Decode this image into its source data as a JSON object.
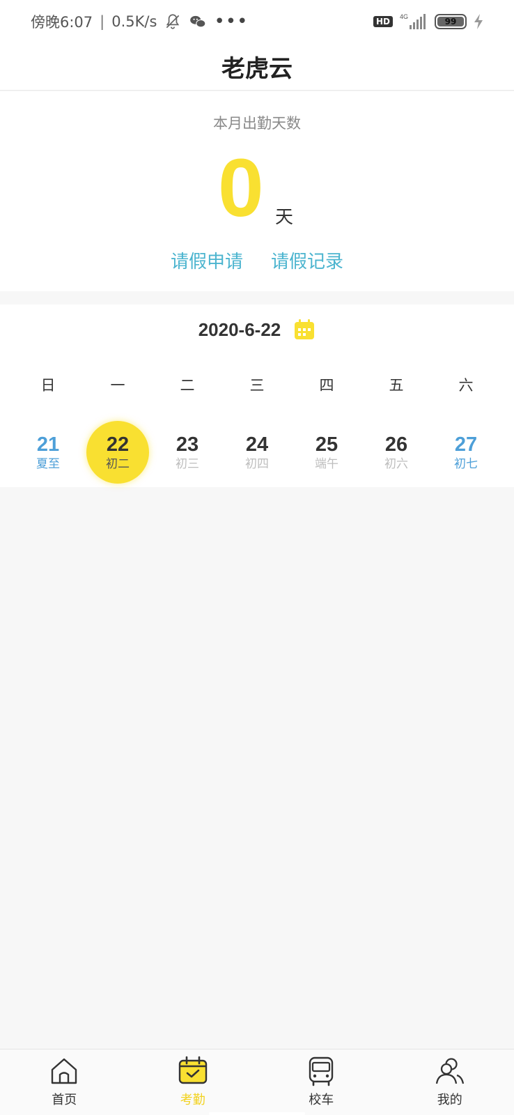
{
  "status_bar": {
    "time": "傍晚6:07",
    "speed": "0.5K/s",
    "network": "4G",
    "battery": "99",
    "hd": "HD"
  },
  "app": {
    "title": "老虎云"
  },
  "attendance": {
    "label": "本月出勤天数",
    "count": "0",
    "unit": "天",
    "leave_apply": "请假申请",
    "leave_records": "请假记录",
    "accent_color": "#f9e031",
    "link_color": "#4bb4cf"
  },
  "calendar": {
    "current_date": "2020-6-22",
    "weekdays": [
      "日",
      "一",
      "二",
      "三",
      "四",
      "五",
      "六"
    ],
    "days": [
      {
        "num": "21",
        "lunar": "夏至"
      },
      {
        "num": "22",
        "lunar": "初二",
        "selected": true
      },
      {
        "num": "23",
        "lunar": "初三"
      },
      {
        "num": "24",
        "lunar": "初四"
      },
      {
        "num": "25",
        "lunar": "端午"
      },
      {
        "num": "26",
        "lunar": "初六"
      },
      {
        "num": "27",
        "lunar": "初七"
      }
    ],
    "weekend_color": "#4d9fd8"
  },
  "bottom_nav": {
    "items": [
      {
        "label": "首页",
        "icon": "home-icon"
      },
      {
        "label": "考勤",
        "icon": "attendance-calendar-icon",
        "active": true
      },
      {
        "label": "校车",
        "icon": "bus-icon"
      },
      {
        "label": "我的",
        "icon": "profile-icon"
      }
    ],
    "active_color": "#f2d21e"
  }
}
